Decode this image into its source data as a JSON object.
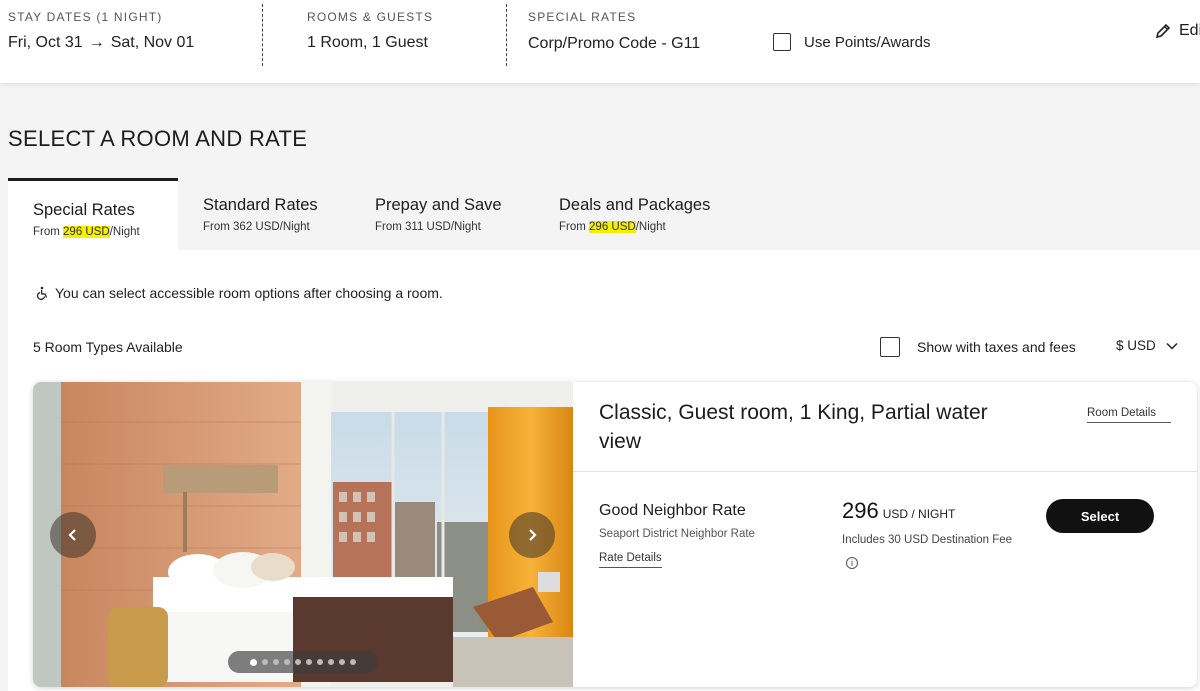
{
  "topbar": {
    "stay_label": "STAY DATES (1 NIGHT)",
    "check_in": "Fri, Oct 31",
    "arrow": "→",
    "check_out": "Sat, Nov 01",
    "rooms_label": "ROOMS & GUESTS",
    "rooms_value": "1 Room, 1 Guest",
    "special_label": "SPECIAL RATES",
    "special_value": "Corp/Promo Code - G11",
    "points_label": "Use Points/Awards",
    "edit_label": "Edit"
  },
  "page_title": "SELECT A ROOM AND RATE",
  "tabs": [
    {
      "name": "Special Rates",
      "prefix": "From ",
      "price": "296 USD",
      "suffix": "/Night",
      "active": true
    },
    {
      "name": "Standard Rates",
      "prefix": "From 362 USD/Night",
      "price": "",
      "suffix": "",
      "active": false
    },
    {
      "name": "Prepay and Save",
      "prefix": "From 311 USD/Night",
      "price": "",
      "suffix": "",
      "active": false
    },
    {
      "name": "Deals and Packages",
      "prefix": "From ",
      "price": "296 USD",
      "suffix": "/Night",
      "active": false
    }
  ],
  "accessible_note": "You can select accessible room options after choosing a room.",
  "room_count": "5 Room Types Available",
  "taxes_label": "Show with taxes and fees",
  "currency": "$ USD",
  "room": {
    "title": "Classic, Guest room, 1 King, Partial water view",
    "details_link": "Room Details",
    "rate_name": "Good Neighbor Rate",
    "rate_sub": "Seaport District Neighbor Rate",
    "rate_details": "Rate Details",
    "price": "296",
    "price_unit": "USD / NIGHT",
    "price_note": "Includes 30 USD Destination Fee",
    "info_icon": "i",
    "select_label": "Select"
  },
  "colors": {
    "highlight": "#f5f000",
    "button": "#111111",
    "accent_wood": "#d89a74",
    "curtain": "#f0a020"
  }
}
